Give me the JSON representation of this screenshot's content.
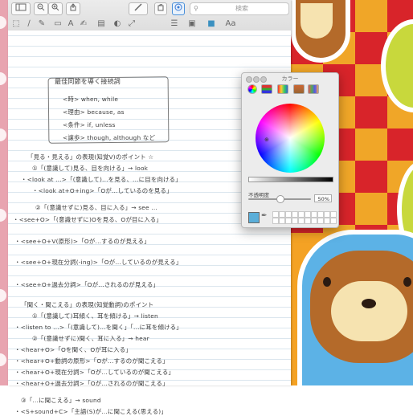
{
  "toolbar": {
    "sidebar_icon": "sidebar-icon",
    "zoom_out_icon": "zoom-out-icon",
    "zoom_in_icon": "zoom-in-icon",
    "share_icon": "share-icon",
    "pen_icon": "pen-icon",
    "rotate_icon": "rotate-icon",
    "markup_icon": "markup-icon",
    "search_placeholder": "検索"
  },
  "notes": {
    "box_title": "最佳同節を導く接続詞",
    "box_lines": [
      "<時>  when,  while",
      "<理由>  because, as",
      "<条件>  if,  unless",
      "<譲歩>  though, although など"
    ],
    "lines": [
      "「見る・見える」の表現(知覚V)のポイント ☆",
      "①「(意識して)見る、目を向ける」→ look",
      "・<look at ...>「(意識して)...を見る、...に目を向ける」",
      "・<look at+O+ing>「Oが...しているのを見る」",
      "②「(意識せずに)見る、目に入る」→ see ...",
      "・<see+O>「(意識せずに)Oを見る、Oが目に入る」",
      "・<see+O+V(原形)>「Oが...するのが見える」",
      "・<see+O+現在分詞(-ing)>「Oが...しているのが見える」",
      "・<see+O+過去分詞>「Oが...されるのが見える」",
      "「聞く・聞こえる」の表現(知覚動詞)のポイント",
      "①「(意識して)耳傾く、耳を傾ける」→ listen",
      "・<listen to ...>「(意識して)...を聞く」「...に耳を傾ける」",
      "②「(意識せずに)聞く、耳に入る」→ hear",
      "・<hear+O>「Oを聞く、Oが耳に入る」",
      "・<hear+O+動詞の原形>「Oが...するのが聞こえる」",
      "・<hear+O+現在分詞>「Oが...しているのが聞こえる」",
      "・<hear+O+過去分詞>「Oが...されるのが聞こえる」",
      "③「...に聞こえる」→ sound",
      "・<S+sound+C>「主語(S)が...に聞こえる(思える)」"
    ]
  },
  "color_panel": {
    "title": "カラー",
    "opacity_label": "不透明度",
    "opacity_value": "50%",
    "opacity_fraction": 0.5,
    "wheel_icon": "color-wheel-icon",
    "sliders_icon": "color-sliders-icon",
    "palettes_icon": "color-palettes-icon",
    "image_icon": "image-palettes-icon",
    "pencils_icon": "pencils-icon",
    "eyedropper_icon": "eyedropper-icon",
    "current_color": "#5aaed9"
  }
}
